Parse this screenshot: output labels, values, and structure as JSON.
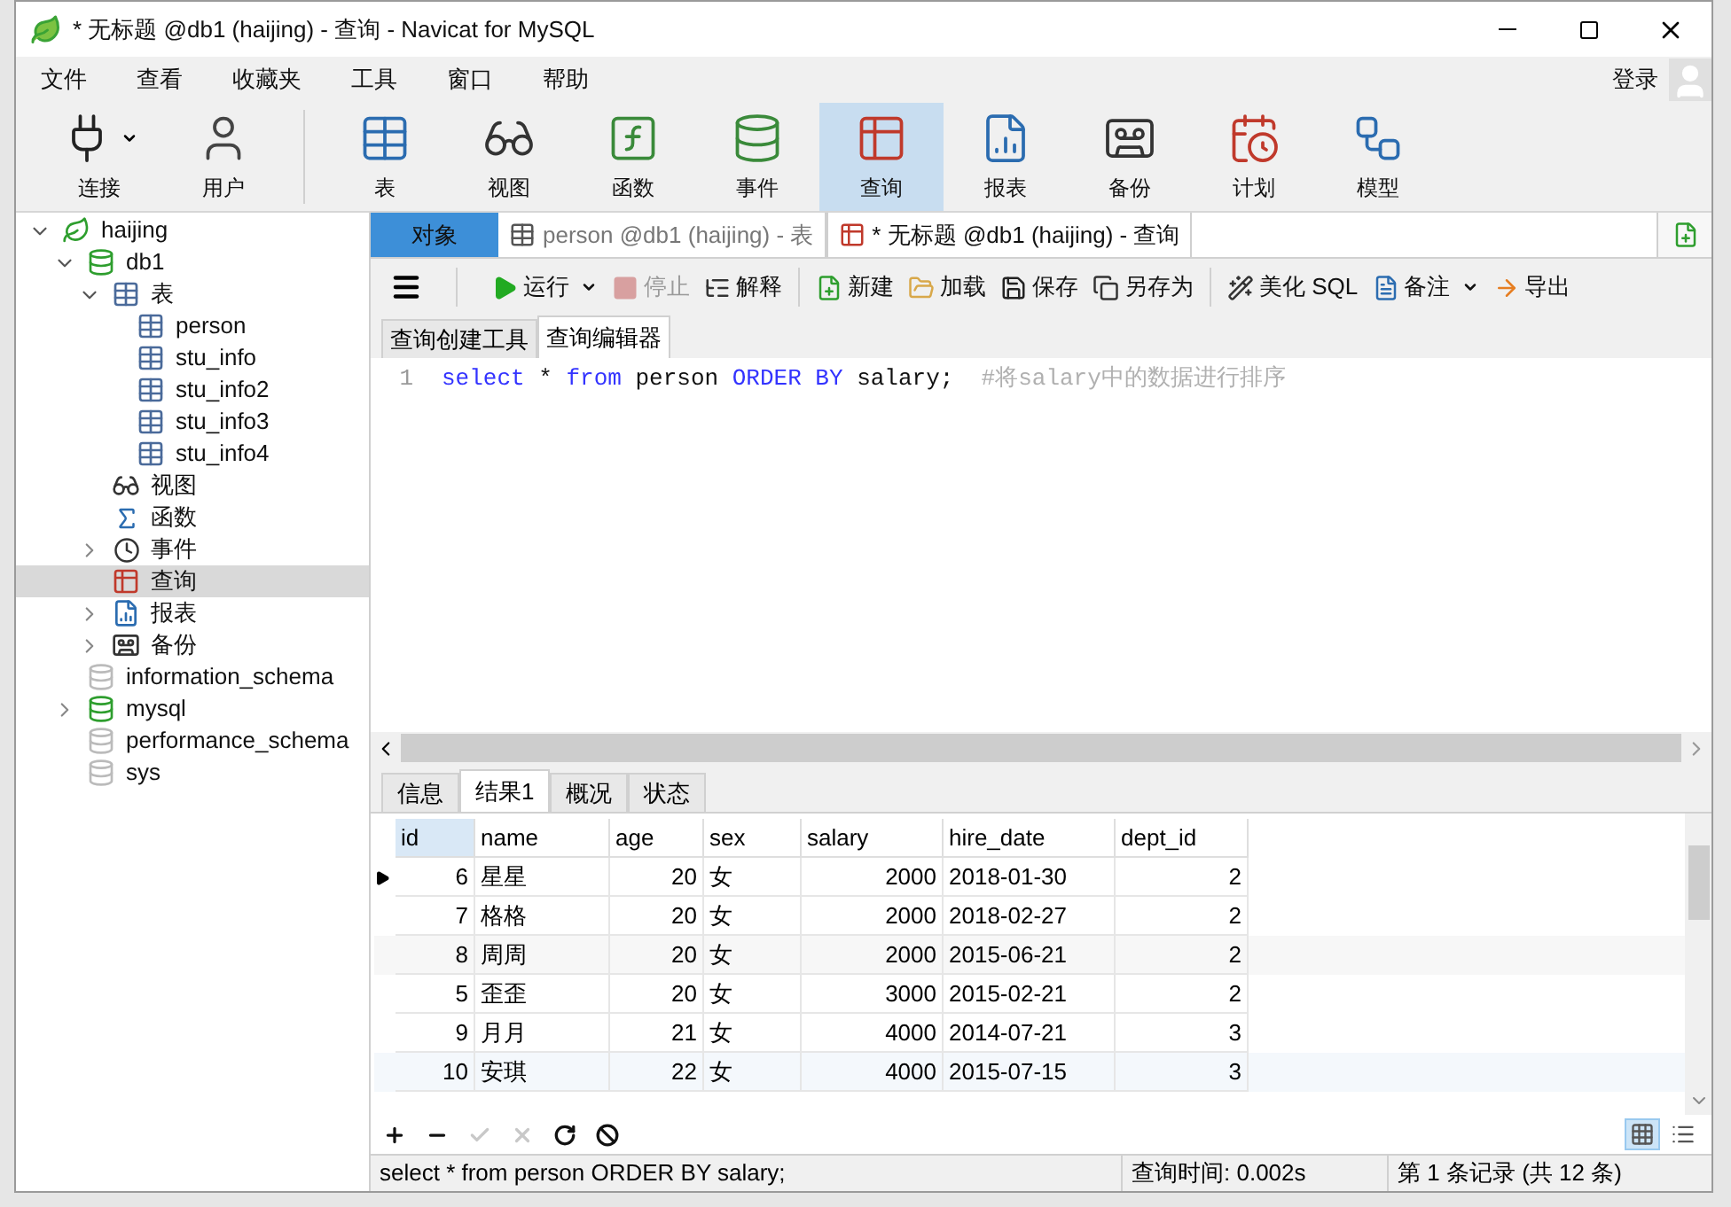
{
  "window": {
    "title": "* 无标题 @db1 (haijing) - 查询 - Navicat for MySQL"
  },
  "menu": [
    "文件",
    "查看",
    "收藏夹",
    "工具",
    "窗口",
    "帮助"
  ],
  "login": "登录",
  "toolbar": [
    {
      "label": "连接",
      "selected": false,
      "dropdown": true
    },
    {
      "label": "用户",
      "selected": false,
      "dropdown": false
    },
    {
      "label": "表",
      "selected": false,
      "dropdown": false
    },
    {
      "label": "视图",
      "selected": false,
      "dropdown": false
    },
    {
      "label": "函数",
      "selected": false,
      "dropdown": false
    },
    {
      "label": "事件",
      "selected": false,
      "dropdown": false
    },
    {
      "label": "查询",
      "selected": true,
      "dropdown": false
    },
    {
      "label": "报表",
      "selected": false,
      "dropdown": false
    },
    {
      "label": "备份",
      "selected": false,
      "dropdown": false
    },
    {
      "label": "计划",
      "selected": false,
      "dropdown": false
    },
    {
      "label": "模型",
      "selected": false,
      "dropdown": false
    }
  ],
  "tree": [
    {
      "label": "haijing",
      "kind": "connection",
      "expanded": true,
      "selected": false,
      "children": [
        {
          "label": "db1",
          "kind": "database",
          "open": true,
          "expanded": true,
          "selected": false,
          "children": [
            {
              "label": "表",
              "kind": "tables",
              "expanded": true,
              "selected": false,
              "children": [
                {
                  "label": "person",
                  "kind": "table",
                  "selected": false
                },
                {
                  "label": "stu_info",
                  "kind": "table",
                  "selected": false
                },
                {
                  "label": "stu_info2",
                  "kind": "table",
                  "selected": false
                },
                {
                  "label": "stu_info3",
                  "kind": "table",
                  "selected": false
                },
                {
                  "label": "stu_info4",
                  "kind": "table",
                  "selected": false
                }
              ]
            },
            {
              "label": "视图",
              "kind": "view",
              "selected": false
            },
            {
              "label": "函数",
              "kind": "function",
              "selected": false
            },
            {
              "label": "事件",
              "kind": "event",
              "expanded": false,
              "selected": false
            },
            {
              "label": "查询",
              "kind": "query",
              "selected": true
            },
            {
              "label": "报表",
              "kind": "report",
              "expanded": false,
              "selected": false
            },
            {
              "label": "备份",
              "kind": "backup",
              "expanded": false,
              "selected": false
            }
          ]
        },
        {
          "label": "information_schema",
          "kind": "database",
          "open": false,
          "selected": false
        },
        {
          "label": "mysql",
          "kind": "database",
          "open": true,
          "expanded": false,
          "selected": false
        },
        {
          "label": "performance_schema",
          "kind": "database",
          "open": false,
          "selected": false
        },
        {
          "label": "sys",
          "kind": "database",
          "open": false,
          "selected": false
        }
      ]
    }
  ],
  "tabs": [
    {
      "label": "对象",
      "kind": "objects",
      "selected": false
    },
    {
      "label": "person @db1 (haijing) - 表",
      "kind": "table",
      "selected": false
    },
    {
      "label": "* 无标题 @db1 (haijing) - 查询",
      "kind": "query",
      "selected": true
    }
  ],
  "query_toolbar": [
    {
      "label": "运行",
      "dropdown": true,
      "disabled": false
    },
    {
      "label": "停止",
      "dropdown": false,
      "disabled": true
    },
    {
      "label": "解释",
      "dropdown": false,
      "disabled": false
    },
    {
      "label": "新建",
      "dropdown": false,
      "disabled": false
    },
    {
      "label": "加载",
      "dropdown": false,
      "disabled": false
    },
    {
      "label": "保存",
      "dropdown": false,
      "disabled": false
    },
    {
      "label": "另存为",
      "dropdown": false,
      "disabled": false
    },
    {
      "label": "美化 SQL",
      "dropdown": false,
      "disabled": false
    },
    {
      "label": "备注",
      "dropdown": true,
      "disabled": false
    },
    {
      "label": "导出",
      "dropdown": false,
      "disabled": false
    }
  ],
  "editor_tabs": [
    {
      "label": "查询创建工具",
      "selected": false
    },
    {
      "label": "查询编辑器",
      "selected": true
    }
  ],
  "editor": {
    "lines": [
      {
        "number": "1",
        "tokens": [
          {
            "text": "select",
            "kind": "keyword"
          },
          {
            "text": " * ",
            "kind": "plain"
          },
          {
            "text": "from",
            "kind": "keyword"
          },
          {
            "text": " person ",
            "kind": "plain"
          },
          {
            "text": "ORDER BY",
            "kind": "keyword"
          },
          {
            "text": " salary;",
            "kind": "plain"
          },
          {
            "text": "  #将salary中的数据进行排序",
            "kind": "comment"
          }
        ]
      }
    ]
  },
  "result_tabs": [
    {
      "label": "信息",
      "selected": false
    },
    {
      "label": "结果1",
      "selected": true
    },
    {
      "label": "概况",
      "selected": false
    },
    {
      "label": "状态",
      "selected": false
    }
  ],
  "table": {
    "columns": [
      {
        "label": "id",
        "numeric": true
      },
      {
        "label": "name",
        "numeric": false
      },
      {
        "label": "age",
        "numeric": true
      },
      {
        "label": "sex",
        "numeric": false
      },
      {
        "label": "salary",
        "numeric": true
      },
      {
        "label": "hire_date",
        "numeric": false
      },
      {
        "label": "dept_id",
        "numeric": true
      }
    ],
    "rows": [
      {
        "current": true,
        "cells": [
          "6",
          "星星",
          "20",
          "女",
          "2000",
          "2018-01-30",
          "2"
        ]
      },
      {
        "current": false,
        "cells": [
          "7",
          "格格",
          "20",
          "女",
          "2000",
          "2018-02-27",
          "2"
        ]
      },
      {
        "current": false,
        "cells": [
          "8",
          "周周",
          "20",
          "女",
          "2000",
          "2015-06-21",
          "2"
        ]
      },
      {
        "current": false,
        "cells": [
          "5",
          "歪歪",
          "20",
          "女",
          "3000",
          "2015-02-21",
          "2"
        ]
      },
      {
        "current": false,
        "cells": [
          "9",
          "月月",
          "21",
          "女",
          "4000",
          "2014-07-21",
          "3"
        ]
      },
      {
        "current": false,
        "cells": [
          "10",
          "安琪",
          "22",
          "女",
          "4000",
          "2015-07-15",
          "3"
        ]
      }
    ]
  },
  "grid_toolbar": [
    {
      "kind": "add",
      "disabled": false
    },
    {
      "kind": "delete",
      "disabled": false
    },
    {
      "kind": "apply",
      "disabled": true
    },
    {
      "kind": "discard",
      "disabled": true
    },
    {
      "kind": "refresh",
      "disabled": false
    },
    {
      "kind": "stop",
      "disabled": false
    }
  ],
  "view_modes": [
    {
      "kind": "grid",
      "selected": true
    },
    {
      "kind": "form",
      "selected": false
    }
  ],
  "status_bar": {
    "sql": "select * from person ORDER BY salary;",
    "time": "查询时间: 0.002s",
    "records": "第 1 条记录 (共 12 条)"
  }
}
